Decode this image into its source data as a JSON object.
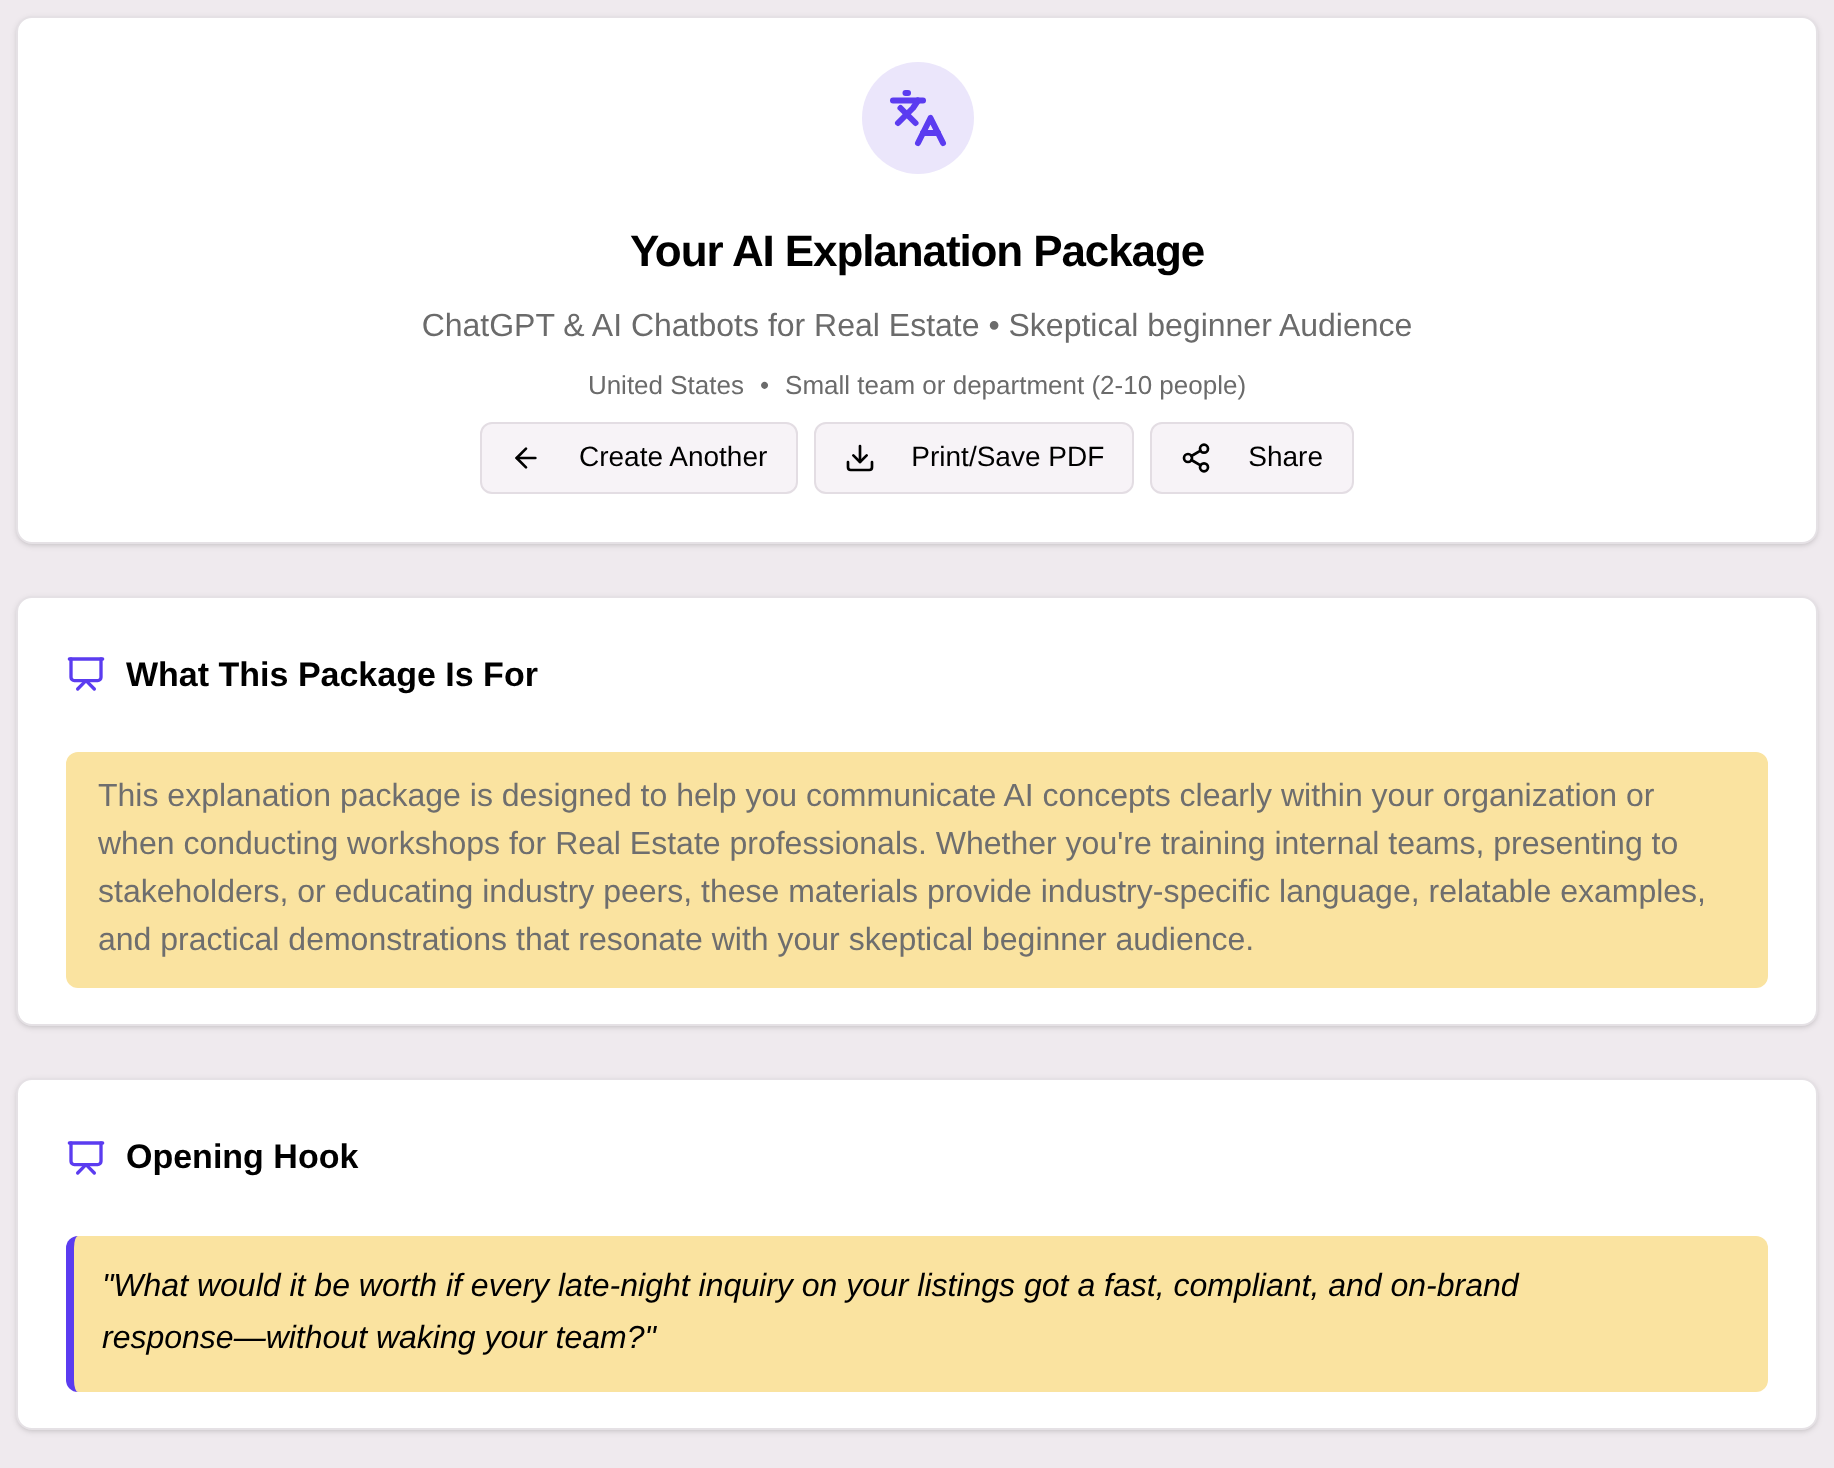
{
  "header": {
    "title": "Your AI Explanation Package",
    "subtitle": "ChatGPT & AI Chatbots for Real Estate • Skeptical beginner Audience",
    "meta": [
      "United States",
      "Small team or department (2-10 people)"
    ],
    "meta_separator": "•",
    "buttons": [
      {
        "label": "Create Another",
        "kind": "back"
      },
      {
        "label": "Print/Save PDF",
        "kind": "download"
      },
      {
        "label": "Share",
        "kind": "share"
      }
    ]
  },
  "sections": [
    {
      "title": "What This Package Is For",
      "kind": "plain",
      "text": "This explanation package is designed to help you communicate AI concepts clearly within your organization or when conducting workshops for Real Estate professionals. Whether you're training internal teams, presenting to stakeholders, or educating industry peers, these materials provide industry-specific language, relatable examples, and practical demonstrations that resonate with your skeptical beginner audience."
    },
    {
      "title": "Opening Hook",
      "kind": "quote",
      "text": "\"What would it be worth if every late-night inquiry on your listings got a fast, compliant, and on-brand response—without waking your team?\""
    }
  ]
}
